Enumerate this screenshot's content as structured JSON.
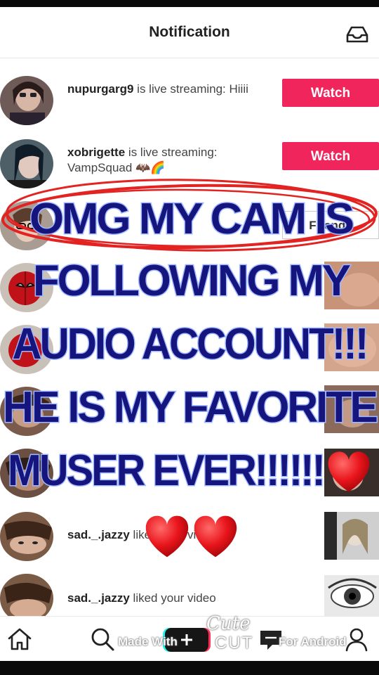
{
  "header": {
    "title": "Notification",
    "inbox_icon": "inbox-icon"
  },
  "notifications": [
    {
      "user": "nupurgarg9",
      "text": " is live streaming: Hiiii",
      "action": "Watch"
    },
    {
      "user": "xobrigette",
      "text": " is live streaming: VampSquad 🦇🌈",
      "action": "Watch"
    },
    {
      "user": "sad._.jazzy",
      "text": " liked your video"
    },
    {
      "user": "sad._.jazzy",
      "text": " liked your video"
    }
  ],
  "overlay": {
    "caption_lines": [
      "OMG MY CAM IS",
      "FOLLOWING MY",
      "AUDIO ACCOUNT!!!",
      "HE IS MY FAVORITE",
      "MUSER EVER!!!!!!"
    ],
    "heart_glyph": "❤️",
    "watermark_left": "Made With",
    "watermark_brand_top": "Cute",
    "watermark_brand_bottom": "CUT",
    "watermark_right": "For Android"
  },
  "colors": {
    "watch_button": "#f0255b",
    "caption_fill": "#16157e",
    "caption_outline": "#9fb8ff",
    "circle_scribble": "#e32222"
  },
  "tabbar_icons": [
    "home-icon",
    "search-icon",
    "plus-icon",
    "message-icon",
    "profile-icon"
  ]
}
